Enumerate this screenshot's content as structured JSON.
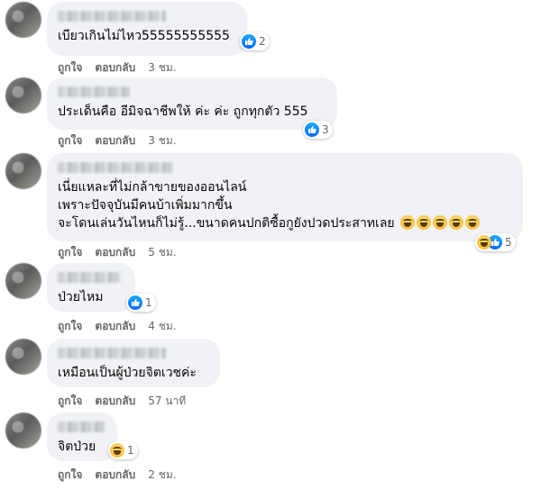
{
  "labels": {
    "like": "ถูกใจ",
    "reply": "ตอบกลับ"
  },
  "colors": {
    "like_blue": "#0866ff",
    "bubble_bg": "#f0f2f5",
    "meta_text": "#65676b"
  },
  "comments": [
    {
      "author": "",
      "text": "เบียวเกินไม่ไหว55555555555",
      "reactions": [
        "like-icon"
      ],
      "reaction_count": "2",
      "time": "3 ชม."
    },
    {
      "author": "",
      "text": "ประเด็นคือ อีมิจฉาชีพให้ ค่ะ ค่ะ ถูกทุกตัว 555",
      "reactions": [
        "like-icon"
      ],
      "reaction_count": "3",
      "time": "3 ชม."
    },
    {
      "author": "",
      "text_lines": [
        "เนี่ยแหละที่ไม่กล้าขายของออนไลน์",
        "เพราะปัจจุบันมีคนบ้าเพิ่มมากขึ้น",
        "จะโดนเล่นวันไหนก็ไม่รู้...ขนาดคนปกติซื้อกูยังปวดประสาทเลย"
      ],
      "emojis": [
        "haha-emoji",
        "haha-emoji",
        "haha-emoji",
        "haha-emoji",
        "haha-emoji"
      ],
      "reactions": [
        "haha-icon",
        "like-icon"
      ],
      "reaction_count": "5",
      "time": "5 ชม."
    },
    {
      "author": "",
      "text": "ป่วยไหม",
      "reactions": [
        "like-icon"
      ],
      "reaction_count": "1",
      "time": "4 ชม."
    },
    {
      "author": "",
      "text": "เหมือนเป็นผู้ป่วยจิตเวชค่ะ",
      "time": "57 นาที"
    },
    {
      "author": "",
      "text": "จิตป่วย",
      "reactions": [
        "haha-icon"
      ],
      "reaction_count": "1",
      "time": "2 ชม."
    }
  ]
}
